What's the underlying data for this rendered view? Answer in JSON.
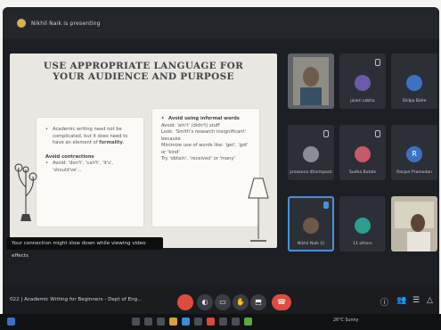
{
  "topbar": {
    "presenter": "Nikhil Naik is presenting"
  },
  "slide": {
    "title_line1": "USE APPROPRIATE LANGUAGE FOR",
    "title_line2": "YOUR AUDIENCE AND PURPOSE",
    "left_card": {
      "para_start": "Academic writing need not be complicated, but it does need to have an element of ",
      "para_bold": "formality",
      "para_end": ".",
      "heading": "Avoid contractions",
      "bullet": "Avoid: 'don't', 'can't', 'it's', 'should've'..."
    },
    "right_card": {
      "heading": "Avoid using informal words",
      "lines": [
        "Avoid: 'ain't' (didn't) stuff",
        "Look: 'Smith's research insignificant' because",
        "Minimize use of words like: 'get', 'got' or 'kind'",
        "Try 'obtain', 'received' or 'many'"
      ]
    },
    "caption": "Your connection might slow down while viewing video effects"
  },
  "participants": [
    {
      "name": "",
      "initial": "",
      "color": "#6a6b62",
      "video": true
    },
    {
      "name": "jaiam sabha",
      "initial": "",
      "color": "#6b5aa8"
    },
    {
      "name": "Shilpa Bahe",
      "initial": "",
      "color": "#3b72c4"
    },
    {
      "name": "prasanna dharmpack",
      "initial": "",
      "color": "#8a8e94"
    },
    {
      "name": "Sudha Butale",
      "initial": "",
      "color": "#c45a6a"
    },
    {
      "name": "Ranjan Pramodan",
      "initial": "R",
      "color": "#3b72c4"
    },
    {
      "name": "Nikhil Naik (i)",
      "initial": "",
      "color": "#6a5a48",
      "active": true
    },
    {
      "name": "11 others",
      "initial": "",
      "color": "#2f9e8f"
    },
    {
      "name": "",
      "initial": "",
      "color": "#8b7f6a",
      "video": true
    }
  ],
  "controlbar": {
    "meeting_title": "022 | Academic Writing for Beginners - Dept of Eng...",
    "controls": [
      {
        "name": "mic-button",
        "glyph": "",
        "red": true
      },
      {
        "name": "camera-button",
        "glyph": "◐",
        "red": false
      },
      {
        "name": "captions-button",
        "glyph": "▭",
        "red": false
      },
      {
        "name": "raise-hand-button",
        "glyph": "✋",
        "red": false
      },
      {
        "name": "present-button",
        "glyph": "⬒",
        "red": false
      },
      {
        "name": "more-options-button",
        "glyph": "⋮",
        "red": false
      },
      {
        "name": "end-call-button",
        "glyph": "☎",
        "red": true
      }
    ],
    "right_icons": [
      "ⓘ",
      "👥",
      "☰",
      "△"
    ]
  },
  "taskbar": {
    "weather": "26°C Sunny"
  }
}
